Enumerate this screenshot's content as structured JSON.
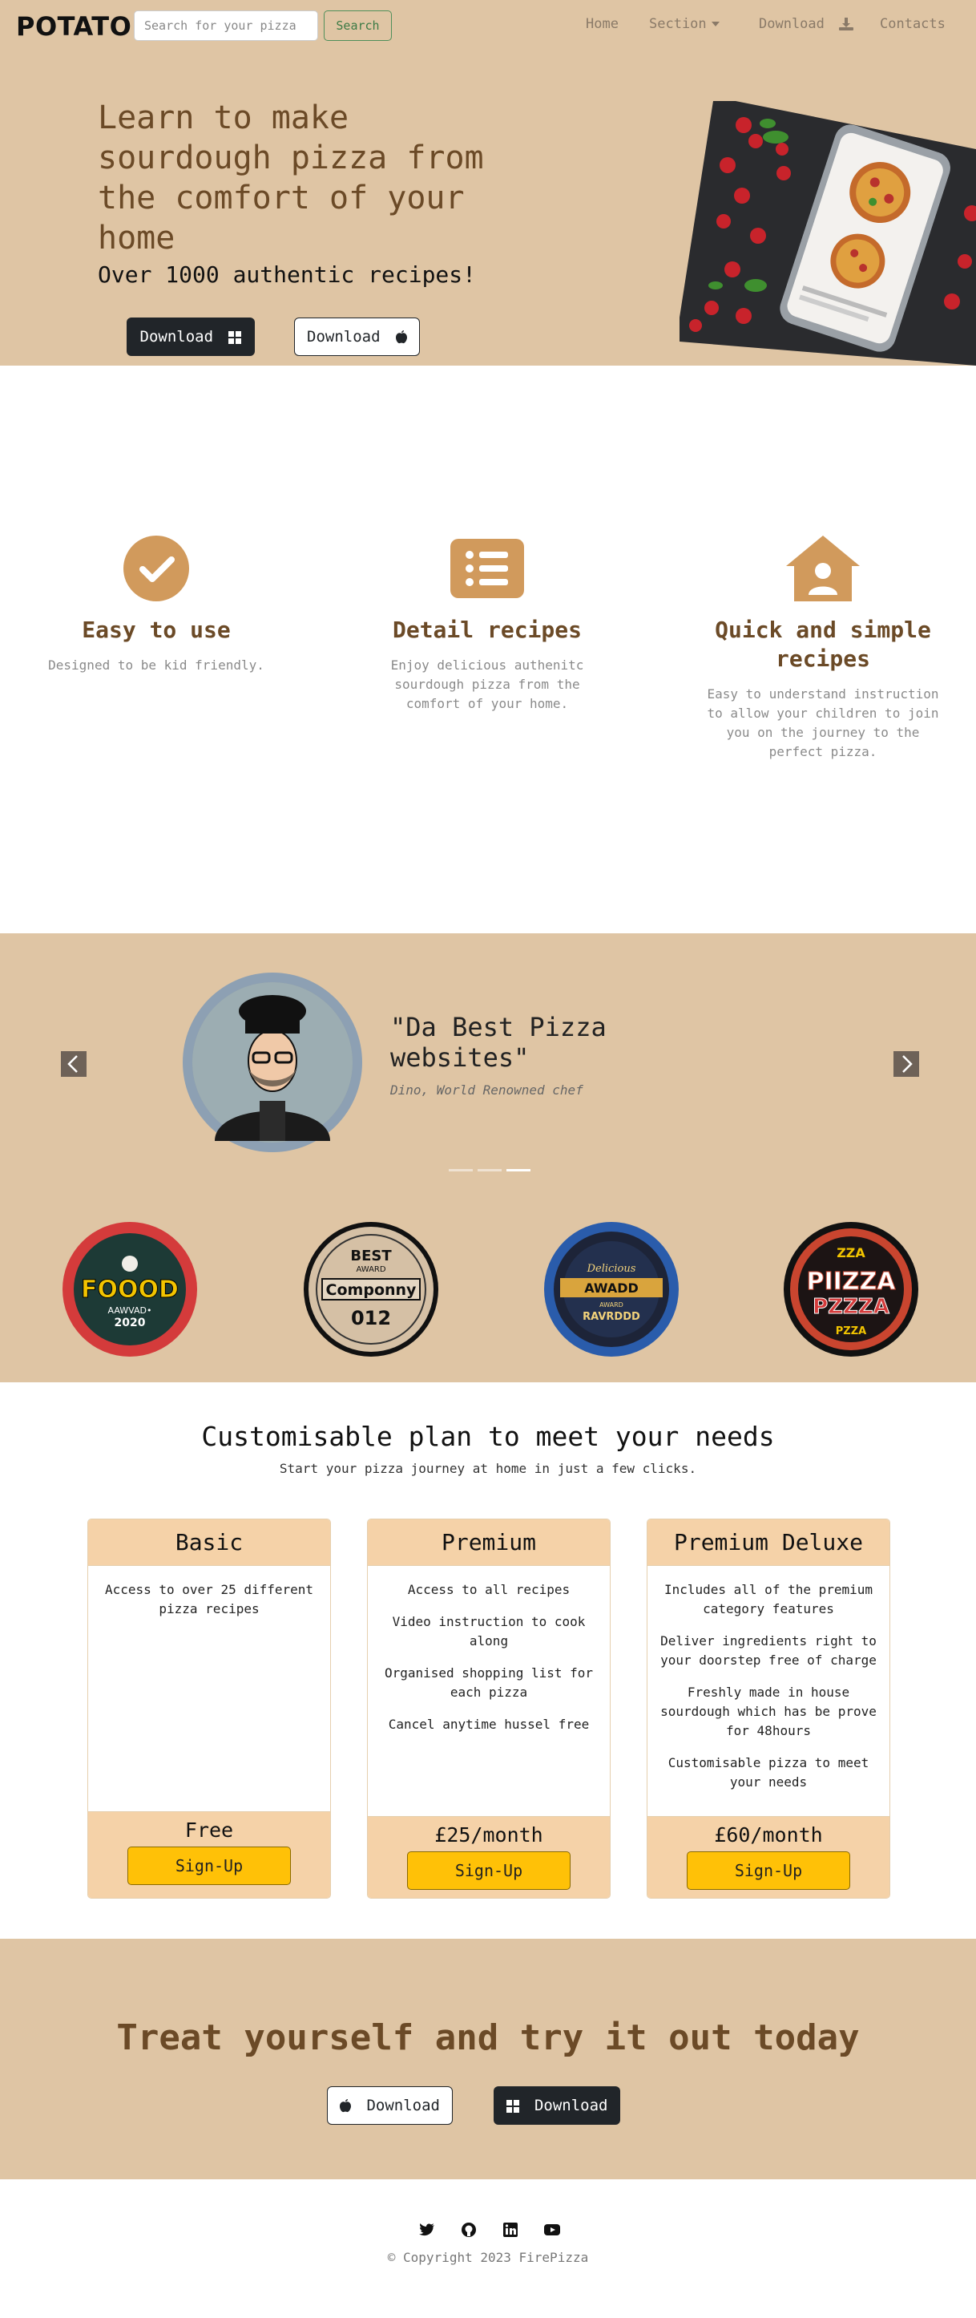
{
  "navbar": {
    "brand": "POTATO",
    "search_placeholder": "Search for your pizza",
    "search_button": "Search",
    "links": {
      "home": "Home",
      "section": "Section",
      "download": "Download",
      "contacts": "Contacts"
    }
  },
  "hero": {
    "title": "Learn to make sourdough pizza from the comfort of your home",
    "subtitle": "Over 1000 authentic recipes!",
    "download_windows": "Download",
    "download_apple": "Download"
  },
  "features": [
    {
      "icon": "check-circle-icon",
      "title": "Easy to use",
      "desc": "Designed to be kid friendly."
    },
    {
      "icon": "list-icon",
      "title": "Detail recipes",
      "desc": "Enjoy delicious authenitc sourdough pizza from the comfort of your home."
    },
    {
      "icon": "house-user-icon",
      "title": "Quick and simple recipes",
      "desc": "Easy to understand instruction to allow your children to join you on the journey to the perfect pizza."
    }
  ],
  "testimonial": {
    "quote": "\"Da Best Pizza websites\"",
    "author": "Dino, World Renowned chef",
    "active_slide": 3,
    "slide_count": 3
  },
  "awards": [
    {
      "lines": [
        "FOOOD",
        "AAWVAD•",
        "2020"
      ],
      "name": "food-award-badge"
    },
    {
      "lines": [
        "BEST",
        "AWARD",
        "Componny",
        "012"
      ],
      "name": "best-company-badge"
    },
    {
      "lines": [
        "Delicious",
        "AWADD",
        "AWARD",
        "RAVRDDD"
      ],
      "name": "delicious-award-badge"
    },
    {
      "lines": [
        "ZZA",
        "PIIZZA",
        "PZZZA",
        "PZZA"
      ],
      "name": "pizza-award-badge"
    }
  ],
  "pricing": {
    "title": "Customisable plan to meet your needs",
    "subtitle": "Start your pizza journey at home in just a few clicks.",
    "plans": [
      {
        "name": "Basic",
        "features": [
          "Access to over 25 different pizza recipes"
        ],
        "price": "Free",
        "cta": "Sign-Up"
      },
      {
        "name": "Premium",
        "features": [
          "Access to all recipes",
          "Video instruction to cook along",
          "Organised shopping list for each pizza",
          "Cancel anytime hussel free"
        ],
        "price": "£25/month",
        "cta": "Sign-Up"
      },
      {
        "name": "Premium Deluxe",
        "features": [
          "Includes all of the premium category features",
          "Deliver ingredients right to your doorstep free of charge",
          "Freshly made in house sourdough which has be prove for 48hours",
          "Customisable pizza to meet your needs"
        ],
        "price": "£60/month",
        "cta": "Sign-Up"
      }
    ]
  },
  "cta": {
    "title": "Treat yourself and try it out today",
    "download_apple": "Download",
    "download_windows": "Download"
  },
  "footer": {
    "copyright": "© Copyright 2023 FirePizza",
    "social": [
      "twitter-icon",
      "github-icon",
      "linkedin-icon",
      "youtube-icon"
    ]
  },
  "colors": {
    "tan_background": "#dfc5a4",
    "brown_accent": "#6b4a27",
    "icon_tan": "#d19a5c",
    "card_header": "#f5d2a8",
    "signup_yellow": "#ffc107"
  }
}
